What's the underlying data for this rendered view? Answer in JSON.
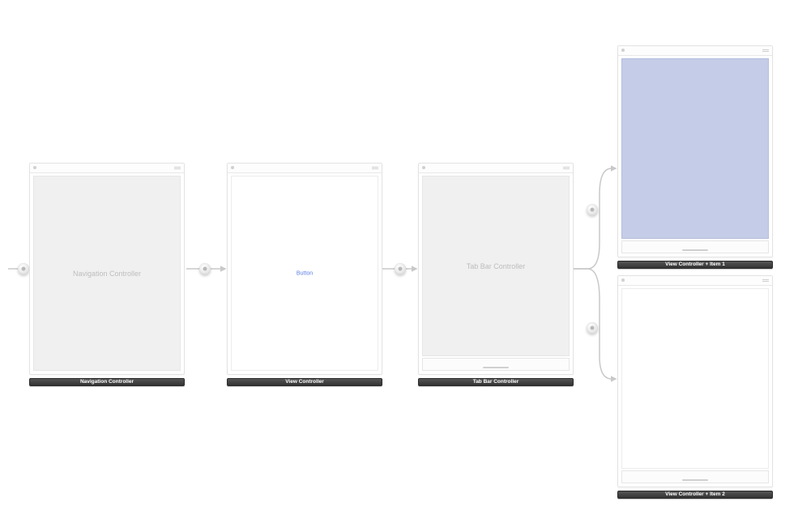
{
  "scenes": {
    "nav": {
      "center": "Navigation Controller",
      "caption": "Navigation Controller"
    },
    "view": {
      "button": "Button",
      "caption": "View Controller"
    },
    "tabbar": {
      "center": "Tab Bar Controller",
      "caption": "Tab Bar Controller"
    },
    "item1": {
      "caption": "View Controller + Item 1"
    },
    "item2": {
      "caption": "View Controller + Item 2"
    }
  },
  "button_color": "#5a7de0"
}
